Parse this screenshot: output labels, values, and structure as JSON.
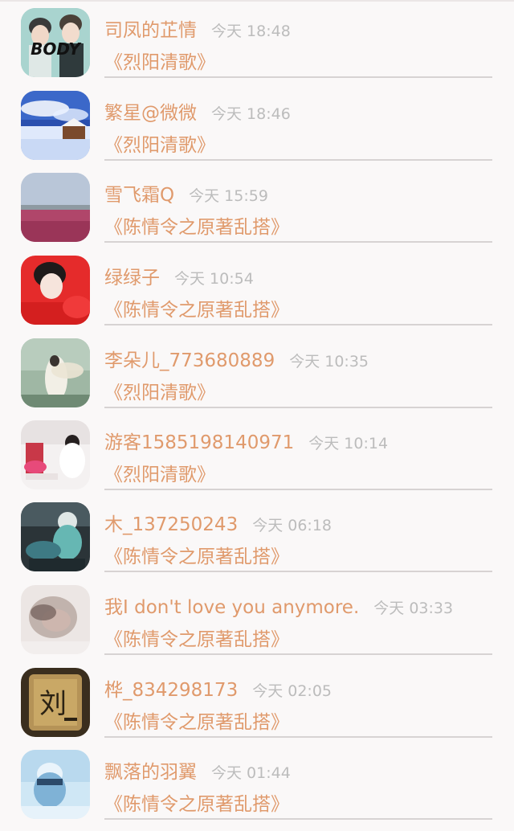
{
  "colors": {
    "accent": "#e09a6c",
    "time_gray": "#bcbcbc",
    "divider": "#d7d3d3",
    "background": "#faf8f8"
  },
  "items": [
    {
      "username": "司凤的芷情",
      "time": "今天 18:48",
      "book": "《烈阳清歌》",
      "avatar_desc": "avatar-photo",
      "avatar_text": "BODY"
    },
    {
      "username": "繁星@微微",
      "time": "今天 18:46",
      "book": "《烈阳清歌》",
      "avatar_desc": "avatar-photo"
    },
    {
      "username": "雪飞霜Q",
      "time": "今天 15:59",
      "book": "《陈情令之原著乱搭》",
      "avatar_desc": "avatar-photo"
    },
    {
      "username": "绿绿子",
      "time": "今天 10:54",
      "book": "《陈情令之原著乱搭》",
      "avatar_desc": "avatar-photo"
    },
    {
      "username": "李朵儿_773680889",
      "time": "今天 10:35",
      "book": "《烈阳清歌》",
      "avatar_desc": "avatar-photo"
    },
    {
      "username": "游客1585198140971",
      "time": "今天 10:14",
      "book": "《烈阳清歌》",
      "avatar_desc": "avatar-photo"
    },
    {
      "username": "木_137250243",
      "time": "今天 06:18",
      "book": "《陈情令之原著乱搭》",
      "avatar_desc": "avatar-photo"
    },
    {
      "username": "我I don't love you anymore.",
      "time": "今天 03:33",
      "book": "《陈情令之原著乱搭》",
      "avatar_desc": "avatar-photo"
    },
    {
      "username": "桦_834298173",
      "time": "今天 02:05",
      "book": "《陈情令之原著乱搭》",
      "avatar_desc": "avatar-photo",
      "avatar_text": "刘"
    },
    {
      "username": "飘落的羽翼",
      "time": "今天 01:44",
      "book": "《陈情令之原著乱搭》",
      "avatar_desc": "avatar-photo"
    }
  ]
}
